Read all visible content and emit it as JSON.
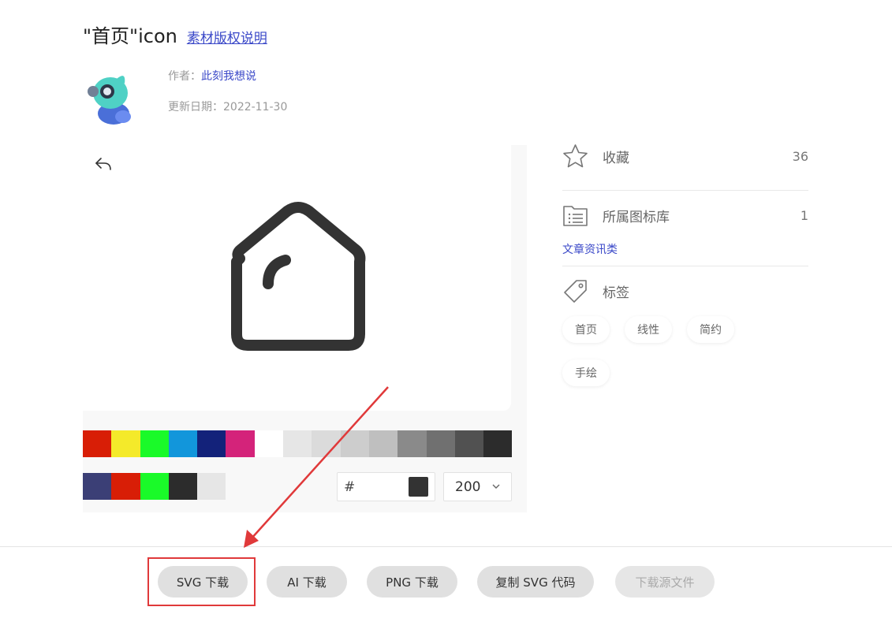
{
  "header": {
    "title": "\"首页\"icon",
    "license_link": "素材版权说明"
  },
  "meta": {
    "author_label": "作者：",
    "author_name": "此刻我想说",
    "date_label": "更新日期：",
    "date_value": "2022-11-30"
  },
  "palette": {
    "row1": [
      "#d81e06",
      "#f4ea2a",
      "#1afa29",
      "#1296db",
      "#13227a",
      "#d4237a",
      "#ffffff",
      "#e6e6e6",
      "#dbdbdb",
      "#cdcdcd",
      "#bfbfbf",
      "#8a8a8a",
      "#707070",
      "#515151",
      "#2c2c2c"
    ],
    "row2": [
      "#3b3f76",
      "#d81e06",
      "#1afa29",
      "#2c2c2c",
      "#e6e6e6"
    ]
  },
  "color_input": {
    "hash": "#",
    "value": "",
    "preview_color": "#333333"
  },
  "size_select": {
    "value": "200"
  },
  "sidebar": {
    "favorites_label": "收藏",
    "favorites_count": "36",
    "library_label": "所属图标库",
    "library_count": "1",
    "library_name": "文章资讯类",
    "tags_label": "标签",
    "tags": [
      "首页",
      "线性",
      "简约",
      "手绘"
    ]
  },
  "actions": {
    "svg_download": "SVG 下载",
    "ai_download": "AI 下载",
    "png_download": "PNG 下载",
    "copy_svg": "复制 SVG 代码",
    "source_download": "下载源文件"
  },
  "colors": {
    "link": "#3a48c8",
    "annotation": "#e0393a",
    "icon_stroke": "#333333"
  }
}
